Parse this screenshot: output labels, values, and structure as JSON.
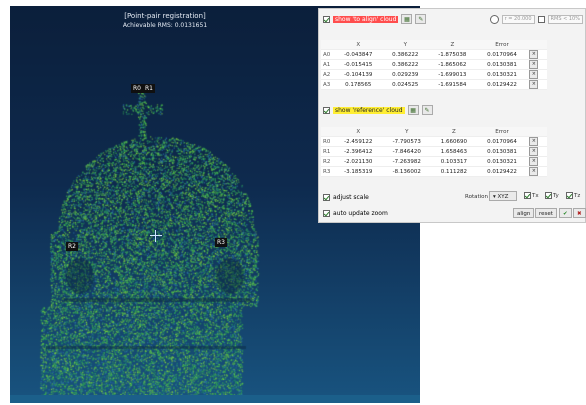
{
  "viewport": {
    "title": "[Point-pair registration]",
    "rms": "Achievable RMS: 0.0131651",
    "labels": [
      "R0",
      "R1",
      "R2",
      "R3"
    ]
  },
  "panel": {
    "to_align_label": "show 'to align' cloud",
    "reference_label": "show 'reference' cloud",
    "radius_value": "r = 20.000",
    "rms_filter_value": "RMS < 10%",
    "columns": [
      "",
      "X",
      "Y",
      "Z",
      "Error",
      ""
    ],
    "aligned_points": [
      {
        "name": "A0",
        "x": "-0.043847",
        "y": "0.386222",
        "z": "-1.875038",
        "err": "0.0170964"
      },
      {
        "name": "A1",
        "x": "-0.015415",
        "y": "0.386222",
        "z": "-1.865062",
        "err": "0.0130381"
      },
      {
        "name": "A2",
        "x": "-0.104139",
        "y": "0.029239",
        "z": "-1.699013",
        "err": "0.0130321"
      },
      {
        "name": "A3",
        "x": "0.178565",
        "y": "0.024525",
        "z": "-1.691584",
        "err": "0.0129422"
      }
    ],
    "reference_points": [
      {
        "name": "R0",
        "x": "-2.459122",
        "y": "-7.790573",
        "z": "1.660690",
        "err": "0.0170964"
      },
      {
        "name": "R1",
        "x": "-2.396412",
        "y": "-7.846420",
        "z": "1.658463",
        "err": "0.0130381"
      },
      {
        "name": "R2",
        "x": "-2.021130",
        "y": "-7.263982",
        "z": "0.103317",
        "err": "0.0130321"
      },
      {
        "name": "R3",
        "x": "-3.185319",
        "y": "-8.136002",
        "z": "0.111282",
        "err": "0.0129422"
      }
    ],
    "delete_symbol": "×",
    "adjust_scale_label": "adjust scale",
    "auto_zoom_label": "auto update zoom",
    "rotation_label": "Rotation",
    "rotation_value": "XYZ",
    "tx_label": "Tx",
    "ty_label": "Ty",
    "tz_label": "Tz",
    "align_button": "align",
    "reset_button": "reset",
    "ok_symbol": "✔",
    "cancel_symbol": "✖"
  }
}
